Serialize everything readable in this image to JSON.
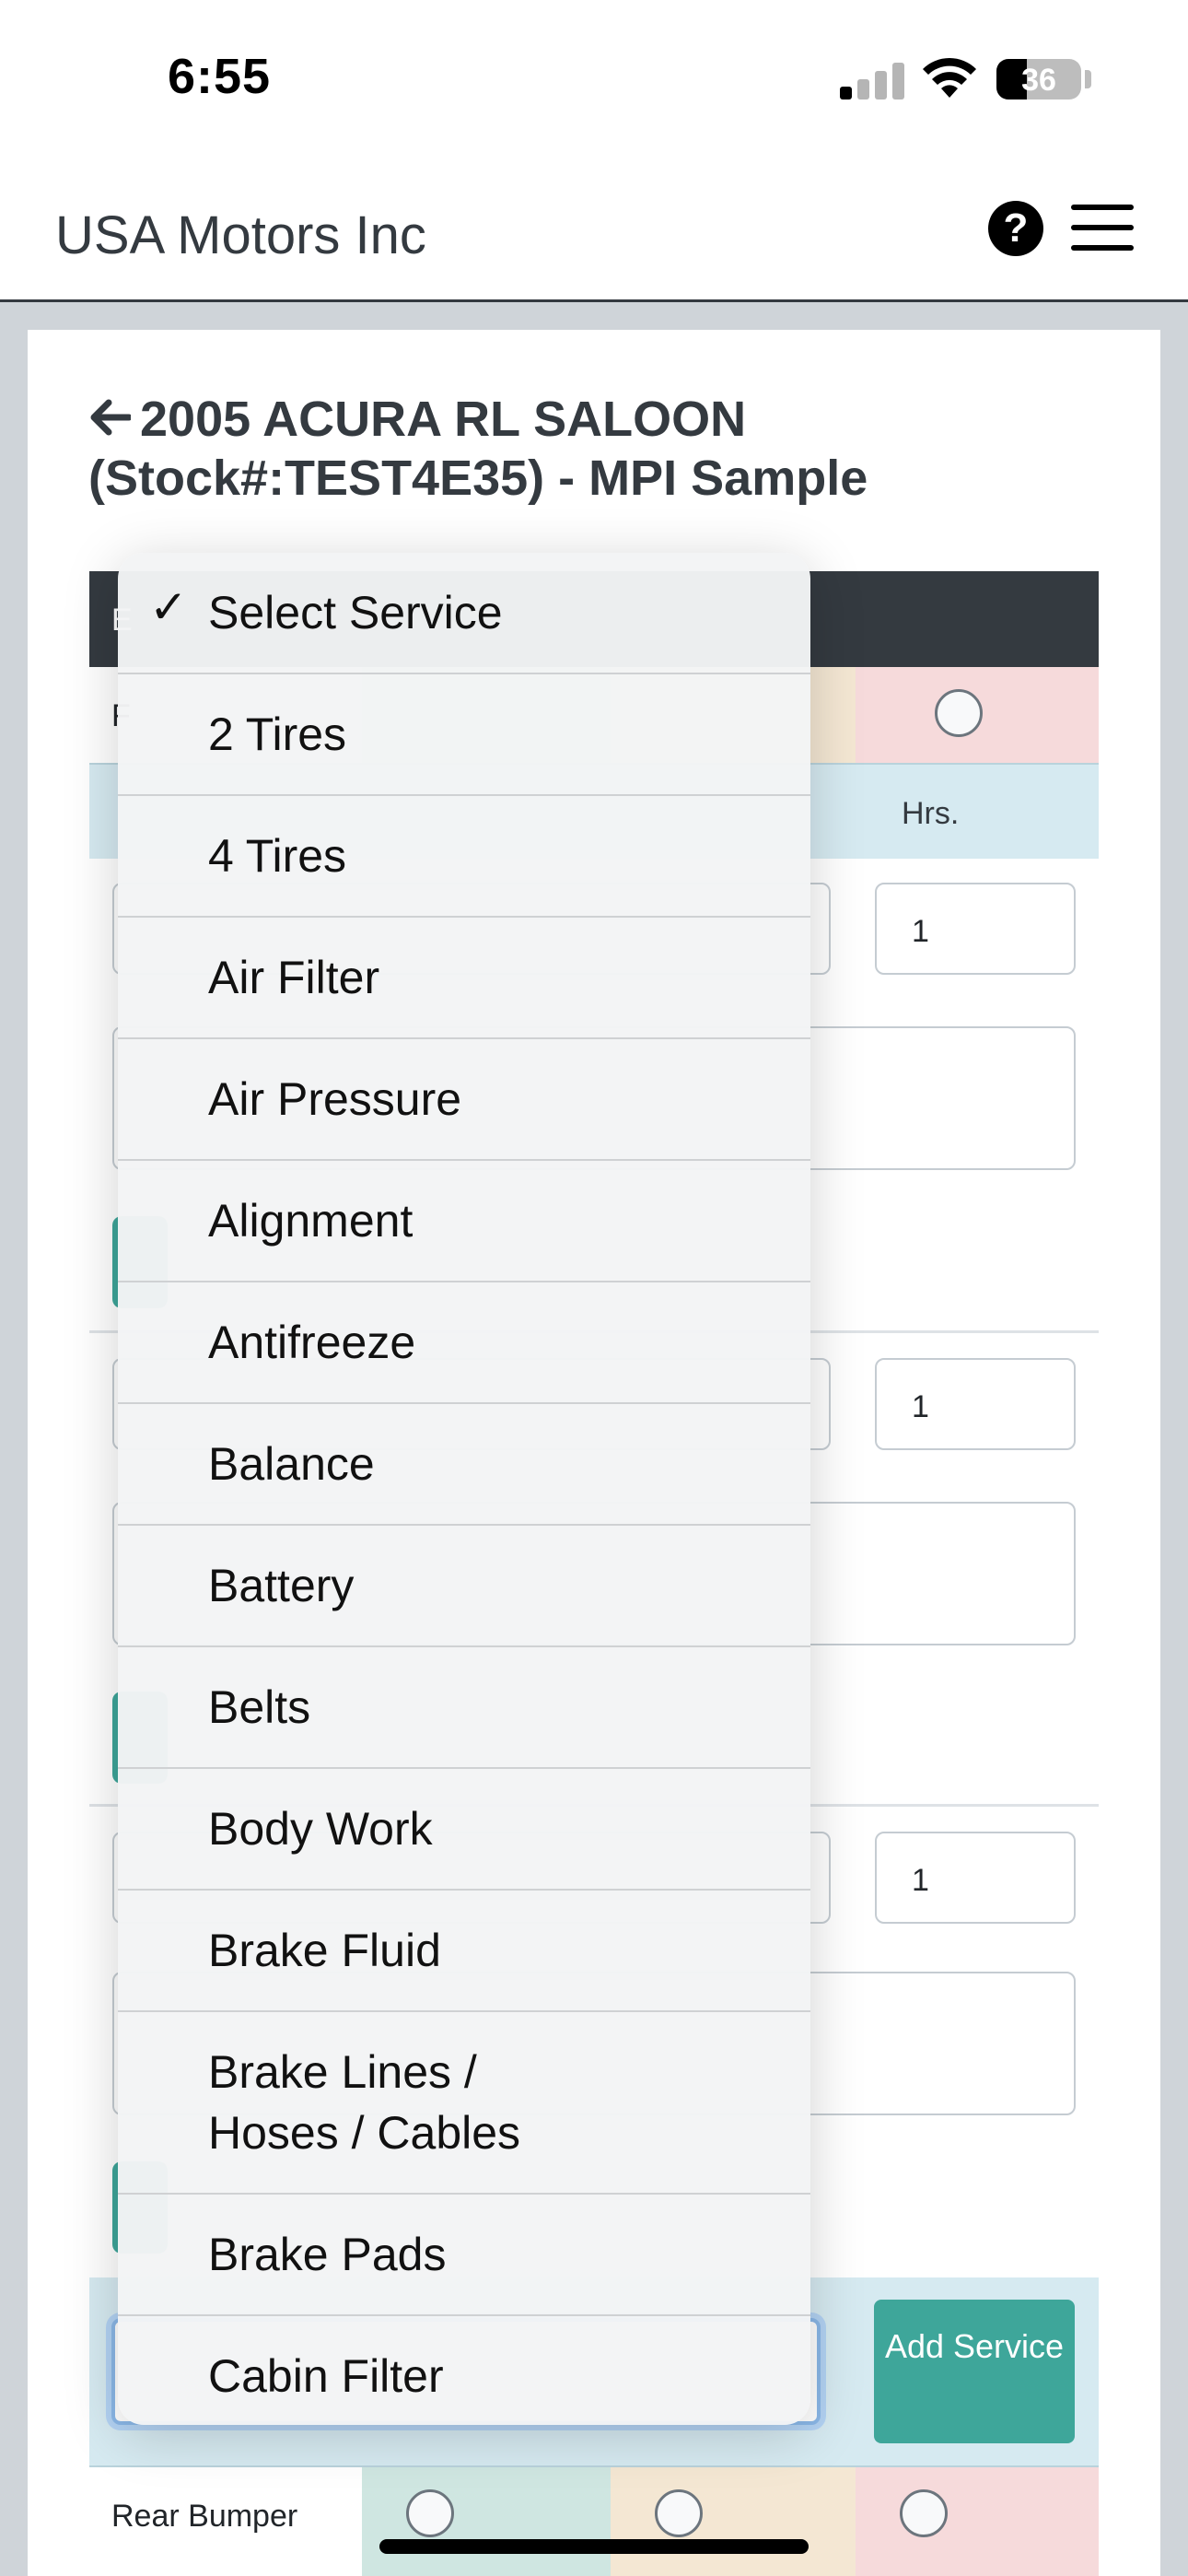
{
  "status_bar": {
    "time": "6:55",
    "battery_percent": "36",
    "signal_bars_active": 1,
    "signal_bars_total": 4
  },
  "navbar": {
    "brand": "USA Motors Inc",
    "help_symbol": "?"
  },
  "page": {
    "back_icon": "arrow-left-icon",
    "title": "2005 ACURA RL SALOON (Stock#:TEST4E35) - MPI Sample"
  },
  "table": {
    "header_stub": "E",
    "rate_row_stub": "F",
    "hrs_label": "Hrs.",
    "rows": [
      {
        "hours": "1"
      },
      {
        "hours": "1"
      },
      {
        "hours": "1"
      }
    ],
    "add_service_label": "Add Service",
    "bumper_label": "Rear Bumper"
  },
  "dropdown": {
    "selected_index": 0,
    "options": [
      "Select Service",
      "2 Tires",
      "4 Tires",
      "Air Filter",
      "Air Pressure",
      "Alignment",
      "Antifreeze",
      "Balance",
      "Battery",
      "Belts",
      "Body Work",
      "Brake Fluid",
      "Brake Lines / Hoses / Cables",
      "Brake Pads",
      "Cabin Filter"
    ]
  },
  "colors": {
    "header_dark": "#343a40",
    "teal": "#3ea69a",
    "good": "#cfe6e1",
    "warn": "#f4e7d3",
    "bad": "#f6dadb",
    "info_row": "#d6eaf1"
  }
}
